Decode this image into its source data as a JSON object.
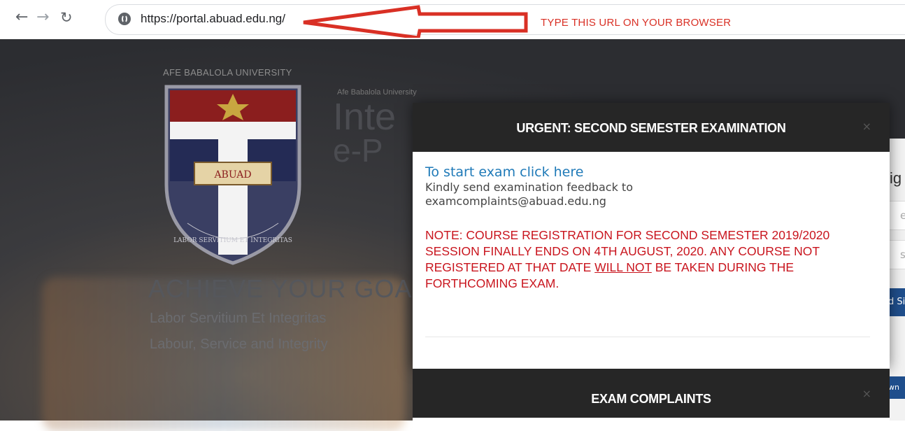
{
  "browser": {
    "back_icon": "arrow-left-icon",
    "forward_icon": "arrow-right-icon",
    "reload_icon": "reload-icon",
    "site_icon": "globe-icon",
    "url": "https://portal.abuad.edu.ng/"
  },
  "annotation": {
    "label": "TYPE THIS URL ON YOUR BROWSER",
    "color": "#d93025"
  },
  "site": {
    "university_name": "AFE BABALOLA UNIVERSITY",
    "small_university": "Afe Babalola University",
    "title_line1": "Inte",
    "title_line2": "e-P",
    "crest_text": "ABUAD",
    "crest_motto": "LABOR SERVITIUM ET INTEGRITAS",
    "achieve": "ACHIEVE YOUR GOAL",
    "motto_latin": "Labor Servitium Et Integritas",
    "motto_english": "Labour, Service and Integrity",
    "login": {
      "heading": "ig",
      "field1": "er",
      "field2": "ss",
      "button1": "d Si",
      "button2": "wn"
    }
  },
  "modal": {
    "title": "URGENT: SECOND SEMESTER EXAMINATION",
    "close": "×",
    "exam_link": "To start exam click here",
    "feedback": "Kindly send examination feedback to examcomplaints@abuad.edu.ng",
    "note_part1": "NOTE: COURSE REGISTRATION FOR SECOND SEMESTER 2019/2020 SESSION FINALLY ENDS ON 4TH AUGUST, 2020. ANY COURSE NOT REGISTERED AT THAT DATE ",
    "note_emphasis": "WILL NOT",
    "note_part2": " BE TAKEN DURING THE FORTHCOMING EXAM.",
    "note_color": "#c9151e",
    "link_color": "#1f7ab8"
  },
  "modal2": {
    "title": "EXAM COMPLAINTS",
    "close": "×"
  }
}
